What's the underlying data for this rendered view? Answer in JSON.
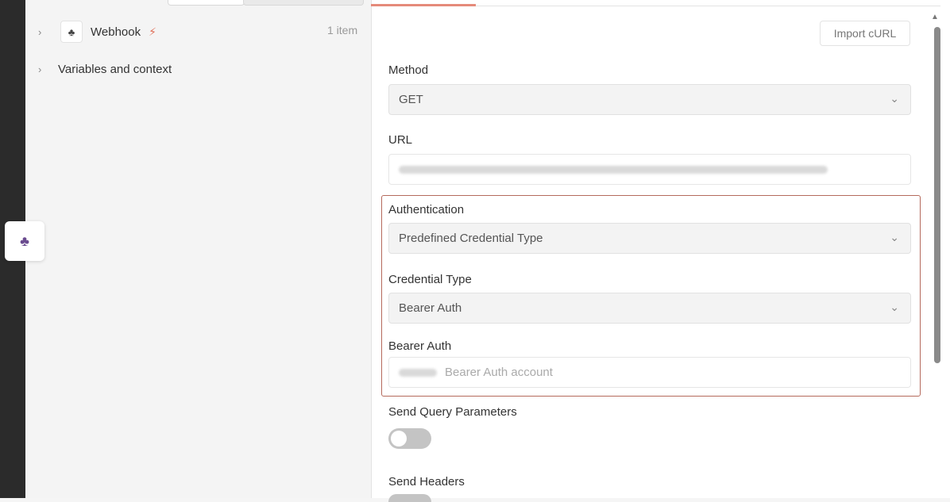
{
  "left_panel": {
    "tree": [
      {
        "label": "Webhook",
        "count": "1 item",
        "icon": "webhook-icon",
        "has_trigger_bolt": true
      },
      {
        "label": "Variables and context"
      }
    ]
  },
  "right_panel": {
    "import_button": "Import cURL",
    "method": {
      "label": "Method",
      "value": "GET"
    },
    "url": {
      "label": "URL",
      "value_blurred": true
    },
    "authentication": {
      "label": "Authentication",
      "value": "Predefined Credential Type"
    },
    "credential_type": {
      "label": "Credential Type",
      "value": "Bearer Auth"
    },
    "bearer_auth": {
      "label": "Bearer Auth",
      "value": "Bearer Auth account"
    },
    "send_query_parameters": {
      "label": "Send Query Parameters",
      "enabled": false
    },
    "send_headers": {
      "label": "Send Headers"
    }
  },
  "colors": {
    "highlight_border": "#b56a5c",
    "active_tab": "#e58a7a",
    "bolt": "#e0705a"
  }
}
